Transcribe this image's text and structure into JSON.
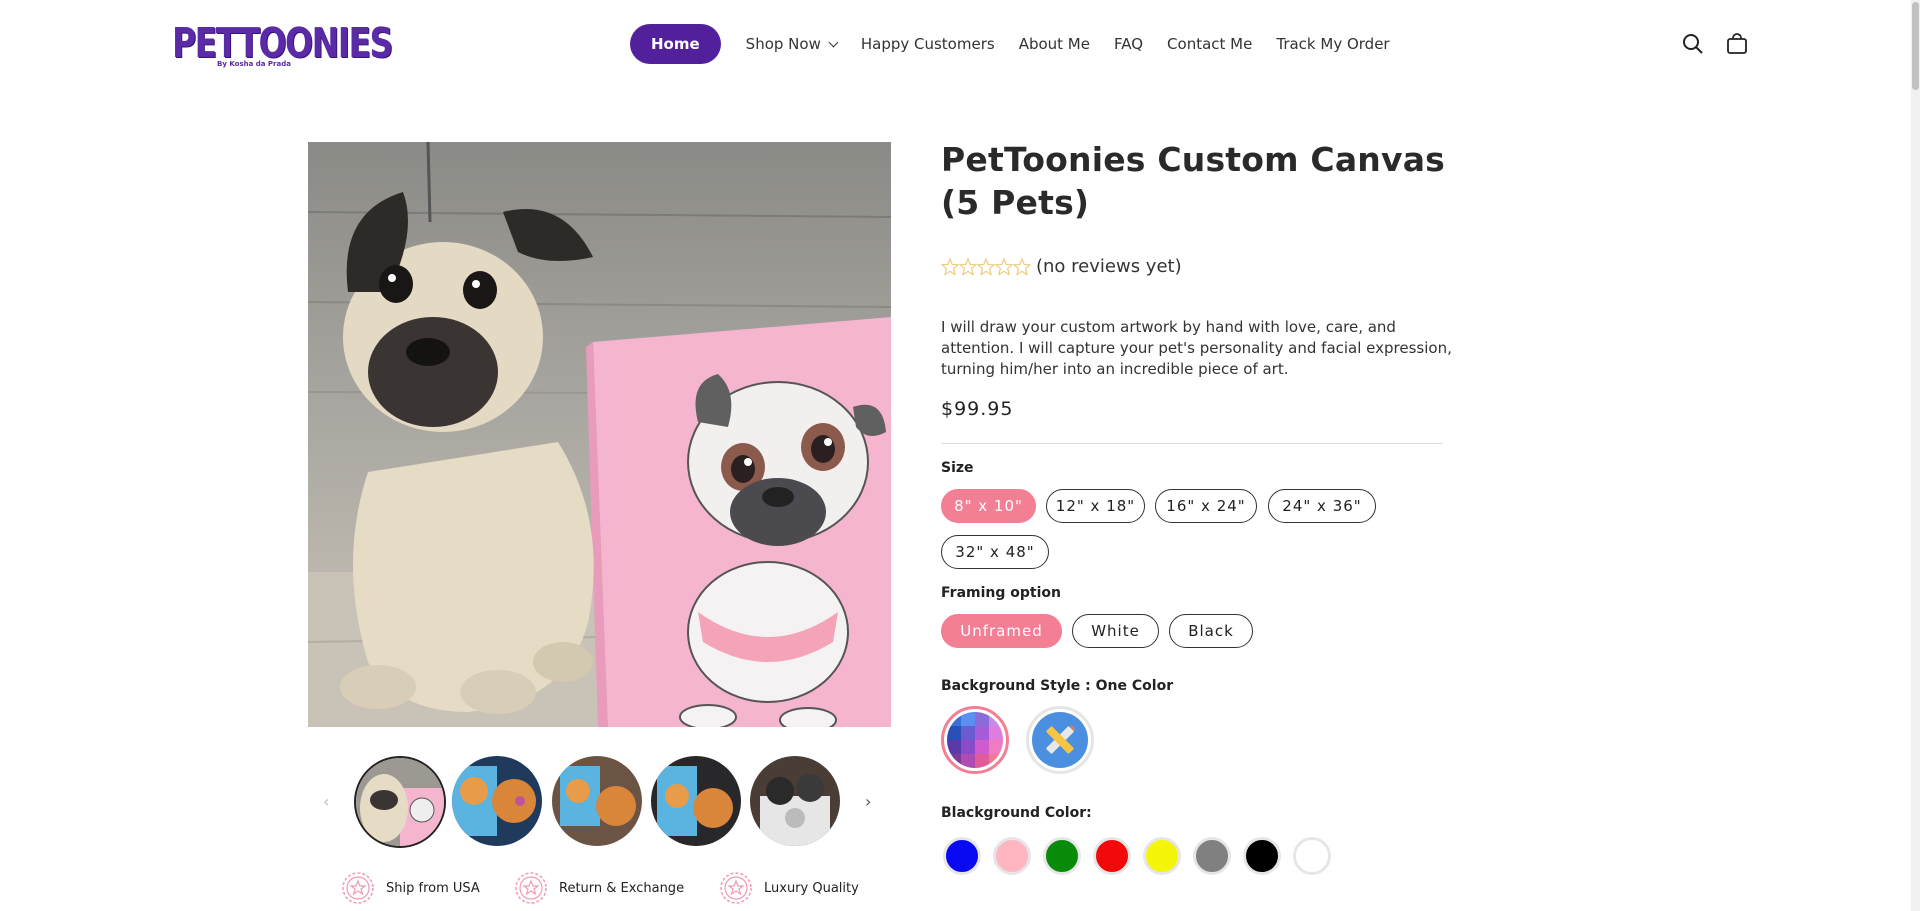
{
  "brand": {
    "name": "PETTOONIES",
    "tagline": "By Kosha da Prada"
  },
  "nav": {
    "items": [
      {
        "label": "Home"
      },
      {
        "label": "Shop Now"
      },
      {
        "label": "Happy Customers"
      },
      {
        "label": "About Me"
      },
      {
        "label": "FAQ"
      },
      {
        "label": "Contact Me"
      },
      {
        "label": "Track My Order"
      }
    ]
  },
  "header_icons": [
    "search-icon",
    "cart-icon"
  ],
  "product": {
    "title": "PetToonies Custom Canvas (5 Pets)",
    "rating_stars": 0,
    "rating_max": 5,
    "reviews_text": "(no reviews yet)",
    "description": "I will draw your custom artwork by hand with love, care, and attention. I will capture your pet's personality and facial expression, turning him/her into an incredible piece of art.",
    "price": "$99.95"
  },
  "options": {
    "size": {
      "label": "Size",
      "values": [
        "8\" x 10\"",
        "12\" x 18\"",
        "16\" x 24\"",
        "24\" x 36\"",
        "32\" x 48\""
      ],
      "selected": "8\" x 10\""
    },
    "framing": {
      "label": "Framing option",
      "values": [
        "Unframed",
        "White",
        "Black"
      ],
      "selected": "Unframed"
    },
    "background_style": {
      "label": "Background Style : One Color",
      "values": [
        "palette-icon",
        "pencil-ruler-icon"
      ]
    },
    "background_color": {
      "label": "Blackground Color:",
      "values": [
        "#0a0af2",
        "#ffb6c1",
        "#0a8a0a",
        "#f20a0a",
        "#f5f50a",
        "#808080",
        "#000000",
        "#ffffff"
      ]
    }
  },
  "gallery": {
    "thumb_count": 5
  },
  "features": [
    {
      "icon": "star-badge-icon",
      "label": "Ship from USA"
    },
    {
      "icon": "star-badge-icon",
      "label": "Return & Exchange"
    },
    {
      "icon": "star-badge-icon",
      "label": "Luxury Quality"
    }
  ],
  "colors": {
    "brand_purple": "#53209b",
    "selected_pink": "#f37f95"
  }
}
